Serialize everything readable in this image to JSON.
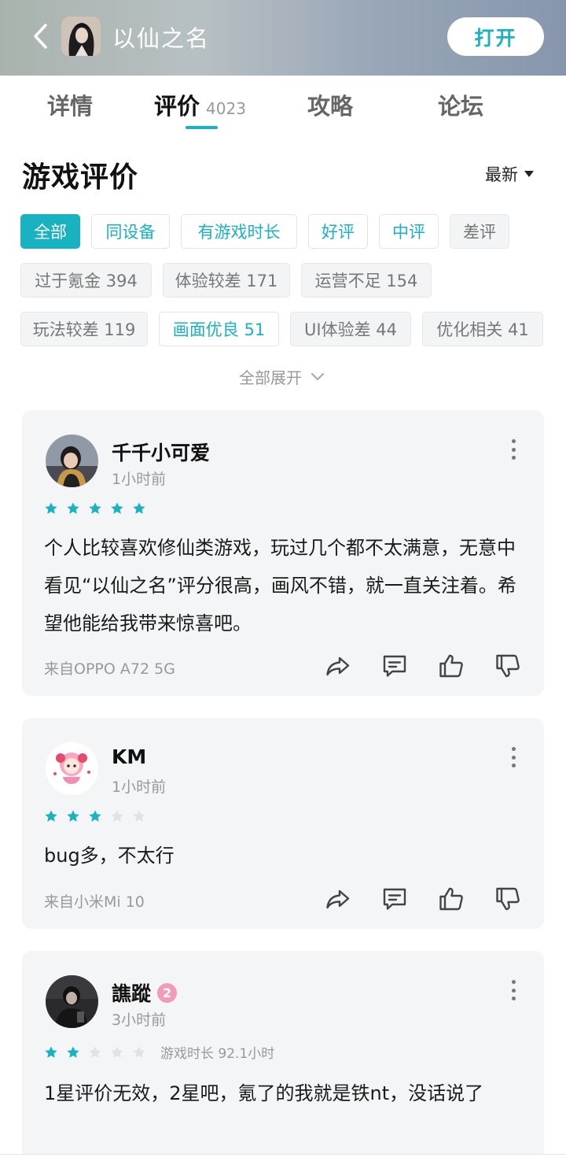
{
  "header": {
    "back_icon": "chevron-left-icon",
    "app_name": "以仙之名",
    "open_label": "打开",
    "accent_color": "#19b2c0"
  },
  "tabs": [
    {
      "label": "详情"
    },
    {
      "label": "评价",
      "count": "4023",
      "active": true
    },
    {
      "label": "攻略"
    },
    {
      "label": "论坛"
    }
  ],
  "section": {
    "title": "游戏评价",
    "sort_label": "最新"
  },
  "filters": {
    "row1": [
      "全部",
      "同设备",
      "有游戏时长",
      "好评",
      "中评",
      "差评"
    ],
    "row2": [
      "过于氪金 394",
      "体验较差 171",
      "运营不足 154"
    ],
    "row3": [
      "玩法较差 119",
      "画面优良 51",
      "UI体验差 44",
      "优化相关 41"
    ],
    "expand_label": "全部展开"
  },
  "reviews": [
    {
      "username": "千千小可爱",
      "time": "1小时前",
      "rating": 5,
      "text": "个人比较喜欢修仙类游戏，玩过几个都不太满意，无意中看见“以仙之名”评分很高，画风不错，就一直关注着。希望他能给我带来惊喜吧。",
      "device": "来自OPPO A72 5G"
    },
    {
      "username": "KM",
      "time": "1小时前",
      "rating": 3,
      "text": "bug多，不太行",
      "device": "来自小米Mi 10"
    },
    {
      "username": "譙蹤",
      "level": "2",
      "time": "3小时前",
      "rating": 2,
      "playtime": "游戏时长 92.1小时",
      "text": "1星评价无效，2星吧，氪了的我就是铁nt，没话说了"
    }
  ]
}
